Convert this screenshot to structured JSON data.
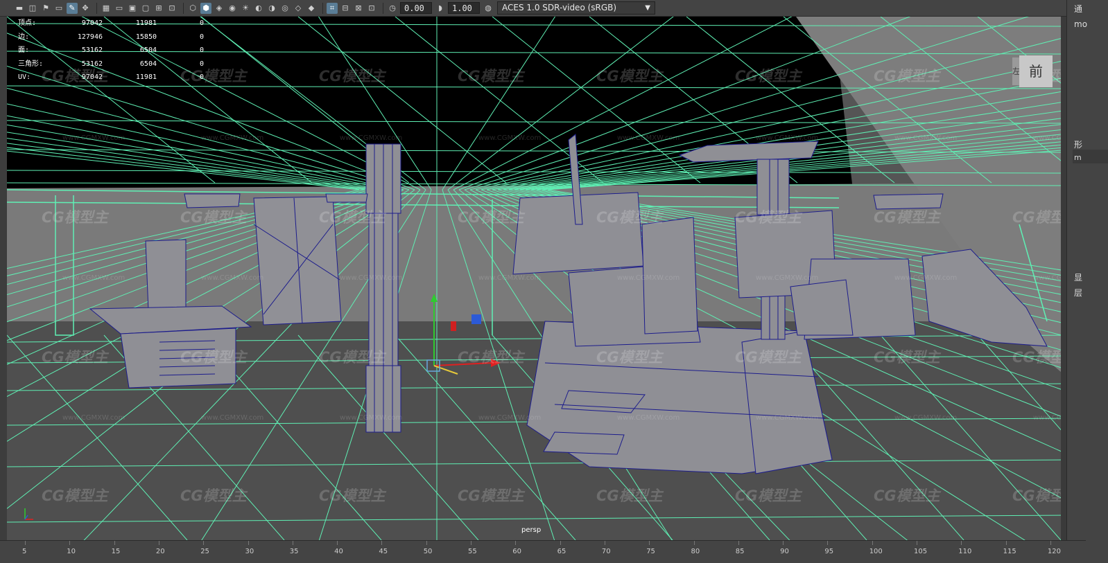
{
  "toolbar": {
    "exposure_value": "0.00",
    "gamma_value": "1.00",
    "color_space": "ACES 1.0 SDR-video (sRGB)",
    "icons": [
      "camera-icon",
      "camera-attr-icon",
      "bookmark-icon",
      "image-plane-icon",
      "grease-pencil-icon",
      "2d-pan-icon",
      "grid-icon",
      "film-gate-icon",
      "resolution-gate-icon",
      "gate-mask-icon",
      "field-chart-icon",
      "safe-action-icon",
      "wireframe-icon",
      "smooth-shade-icon",
      "default-material-icon",
      "textured-icon",
      "use-lights-icon",
      "shadows-icon",
      "ao-icon",
      "motion-blur-icon",
      "aa-icon",
      "dof-icon",
      "isolate-select-icon",
      "xray-icon",
      "xray-joints-icon",
      "xray-components-icon",
      "exposure-icon",
      "gamma-icon",
      "color-mgmt-icon"
    ]
  },
  "hud": {
    "rows": [
      {
        "label": "顶点:",
        "v1": "97042",
        "v2": "11981",
        "v3": "0"
      },
      {
        "label": "边:",
        "v1": "127946",
        "v2": "15850",
        "v3": "0"
      },
      {
        "label": "面:",
        "v1": "53162",
        "v2": "6504",
        "v3": "0"
      },
      {
        "label": "三角形:",
        "v1": "53162",
        "v2": "6504",
        "v3": "0"
      },
      {
        "label": "UV:",
        "v1": "97042",
        "v2": "11981",
        "v3": "0"
      }
    ]
  },
  "viewport": {
    "camera": "persp",
    "view_cube_face": "前",
    "view_cube_side": "左"
  },
  "watermark": {
    "text": "CG模型主",
    "url": "www.CGMXW.com"
  },
  "right_panel": {
    "tab1": "通",
    "tab2": "mo",
    "shape_label": "形",
    "shape_value": "m",
    "display_label": "显",
    "layer_label": "层"
  },
  "ruler": {
    "labels": [
      "5",
      "10",
      "15",
      "20",
      "25",
      "30",
      "35",
      "40",
      "45",
      "50",
      "55",
      "60",
      "65",
      "70",
      "75",
      "80",
      "85",
      "90",
      "95",
      "100",
      "105",
      "110",
      "115",
      "120"
    ]
  },
  "colors": {
    "wire_green": "#5ff0b4",
    "wire_blue": "#1c1c8c",
    "mesh_gray": "#8f8f95",
    "floor": "#4f4f4f",
    "ceiling": "#000000"
  }
}
